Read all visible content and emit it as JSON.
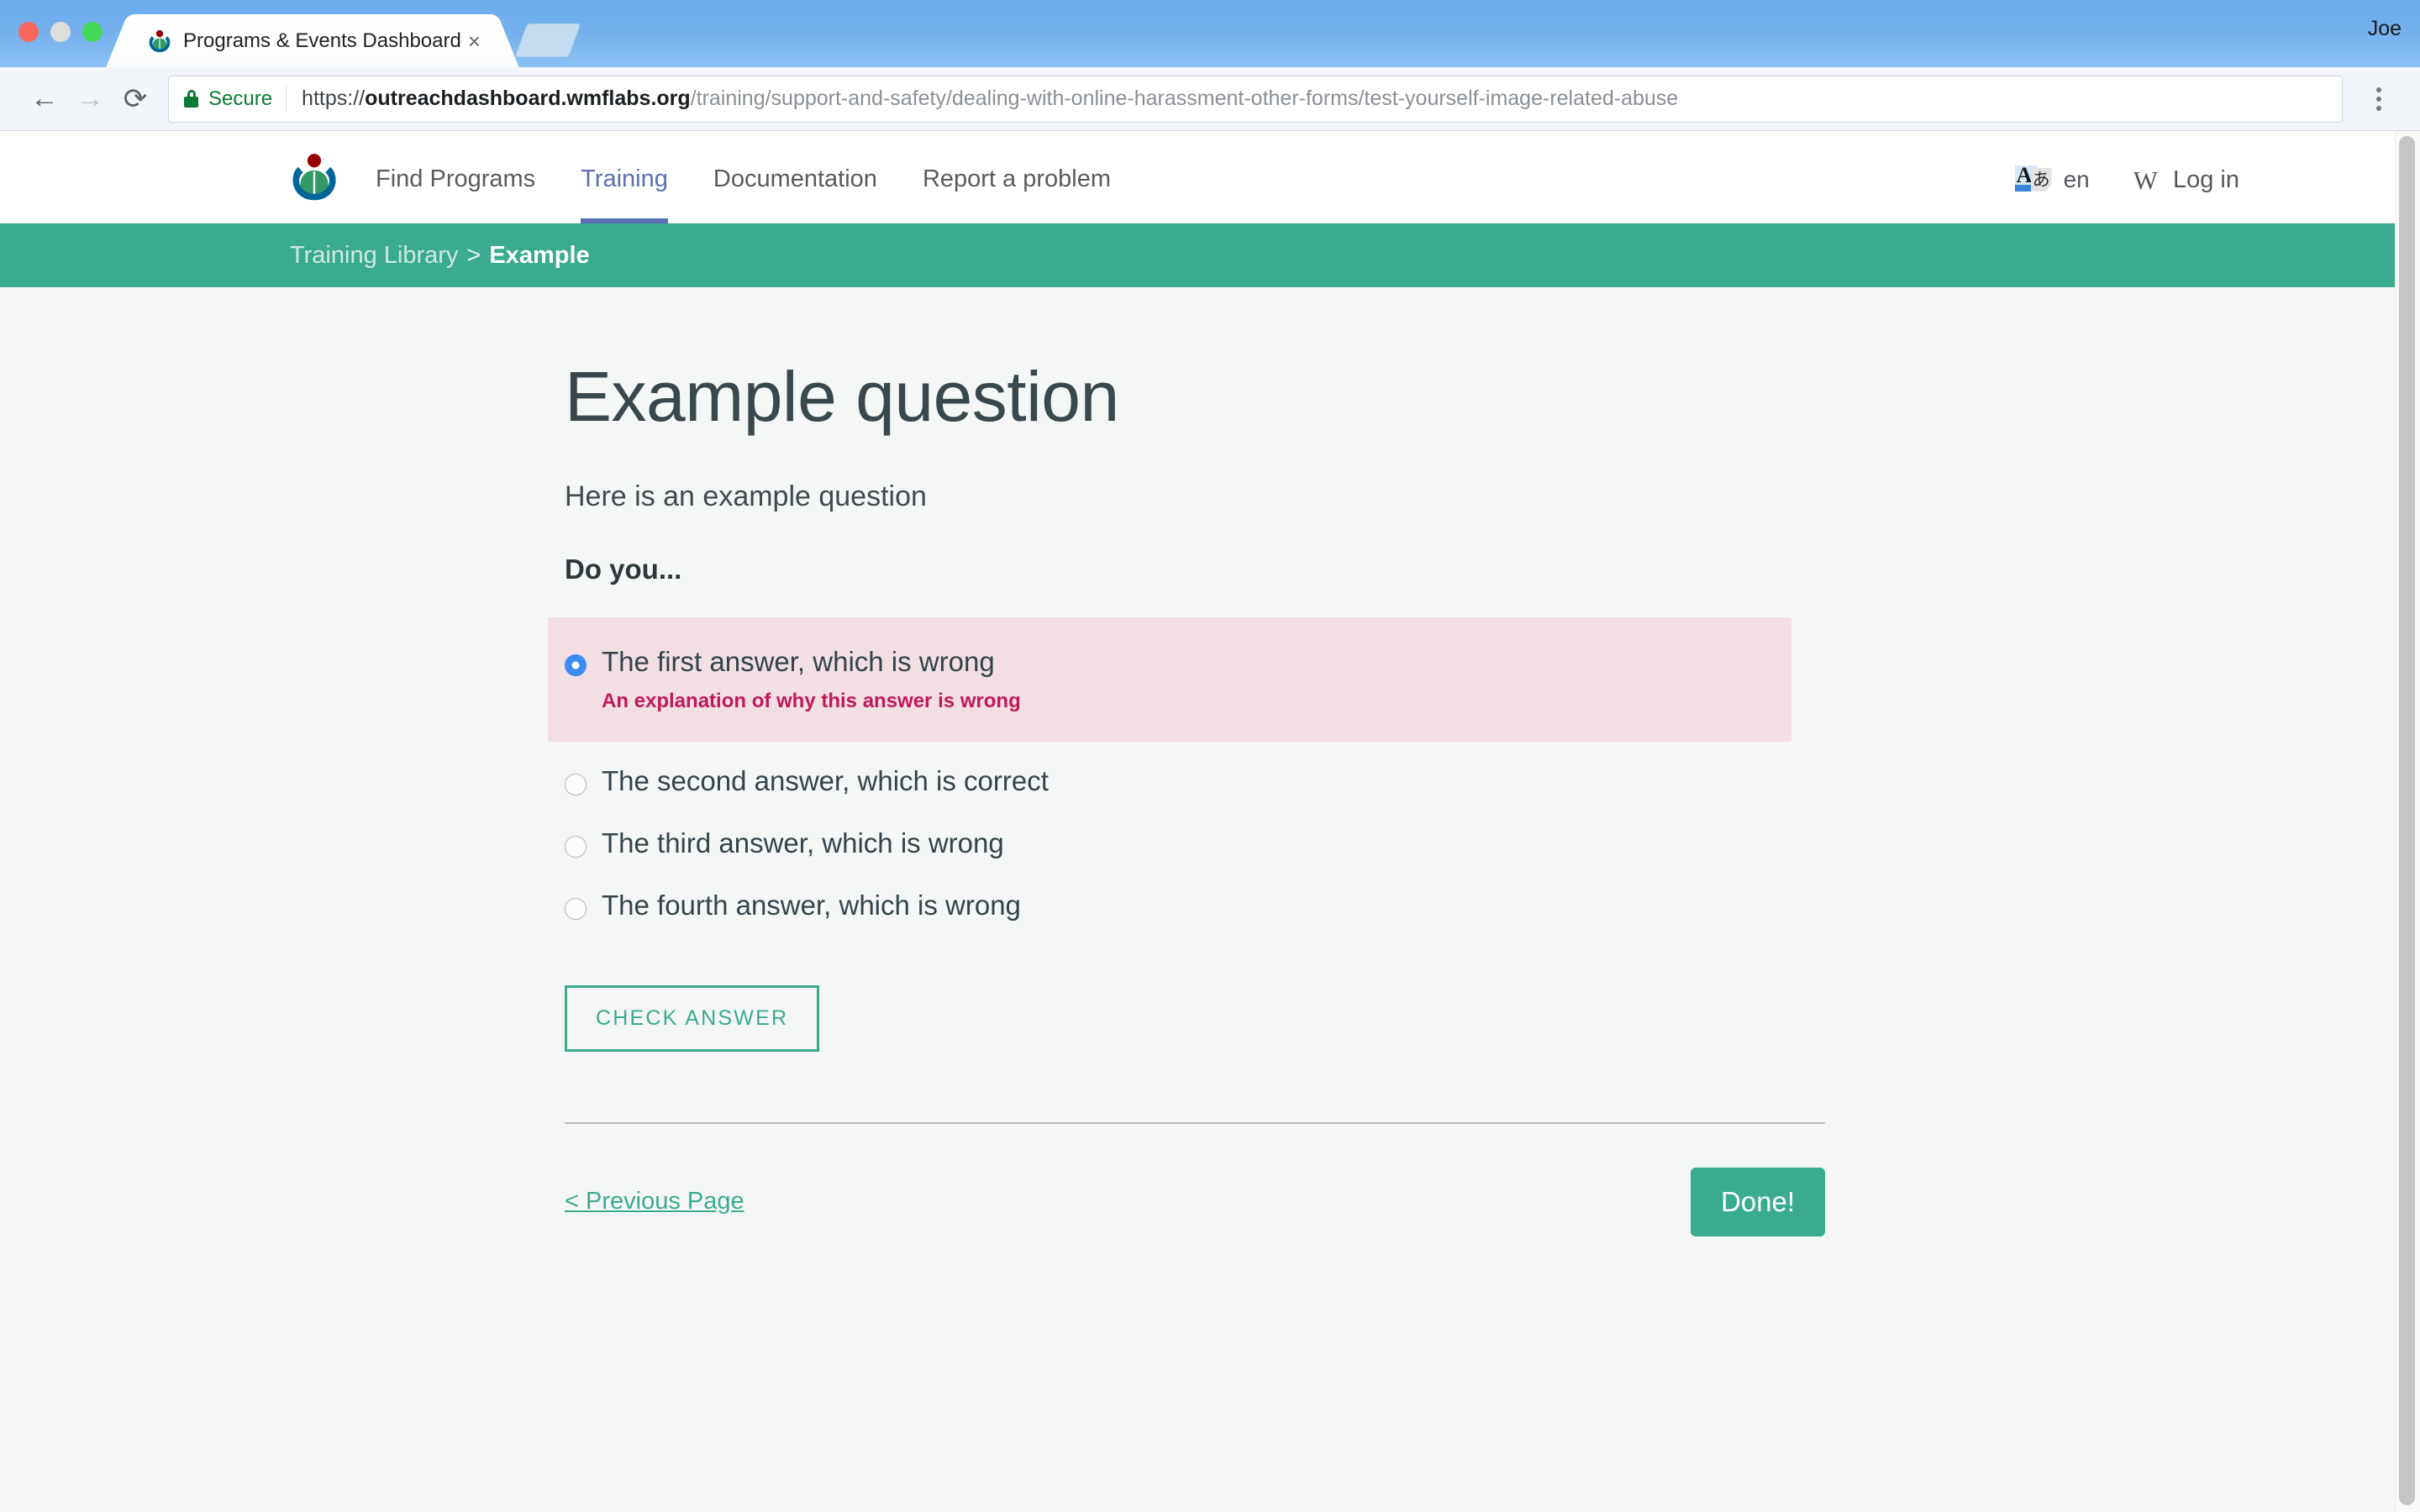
{
  "browser": {
    "window_user": "Joe",
    "tab": {
      "title": "Programs & Events Dashboard",
      "favicon": "wikimedia-logo-icon",
      "close_label": "×"
    },
    "new_tab_label": "+",
    "toolbar": {
      "back_label": "←",
      "forward_label": "→",
      "reload_label": "⟳",
      "security_label": "Secure",
      "url_scheme": "https://",
      "url_host": "outreachdashboard.wmflabs.org",
      "url_path": "/training/support-and-safety/dealing-with-online-harassment-other-forms/test-yourself-image-related-abuse",
      "menu_label": "⋮"
    }
  },
  "site_nav": {
    "logo": "wikimedia-logo-icon",
    "links": [
      {
        "label": "Find Programs",
        "active": false
      },
      {
        "label": "Training",
        "active": true
      },
      {
        "label": "Documentation",
        "active": false
      },
      {
        "label": "Report a problem",
        "active": false
      }
    ],
    "language_icon": "language-switcher-icon",
    "language_glyph_a": "A",
    "language_glyph_b": "あ",
    "language_code": "en",
    "wiki_icon": "W",
    "login_label": "Log in"
  },
  "breadcrumb": {
    "library_label": "Training Library",
    "separator": ">",
    "current_label": "Example"
  },
  "main": {
    "title": "Example question",
    "intro": "Here is an example question",
    "prompt": "Do you...",
    "answers": [
      {
        "label": "The first answer, which is wrong",
        "selected": true,
        "state": "wrong",
        "explanation": "An explanation of why this answer is wrong"
      },
      {
        "label": "The second answer, which is correct",
        "selected": false,
        "state": "none",
        "explanation": ""
      },
      {
        "label": "The third answer, which is wrong",
        "selected": false,
        "state": "none",
        "explanation": ""
      },
      {
        "label": "The fourth answer, which is wrong",
        "selected": false,
        "state": "none",
        "explanation": ""
      }
    ],
    "check_answer_label": "CHECK ANSWER",
    "previous_page_label": "< Previous Page",
    "done_label": "Done!"
  },
  "colors": {
    "accent_green": "#3aab8f",
    "nav_active_purple": "#5c6fb2",
    "wrong_bg": "#f2dfe4",
    "wrong_text": "#c2185b",
    "radio_selected": "#3b8cf5",
    "secure_green": "#0b7a33"
  }
}
